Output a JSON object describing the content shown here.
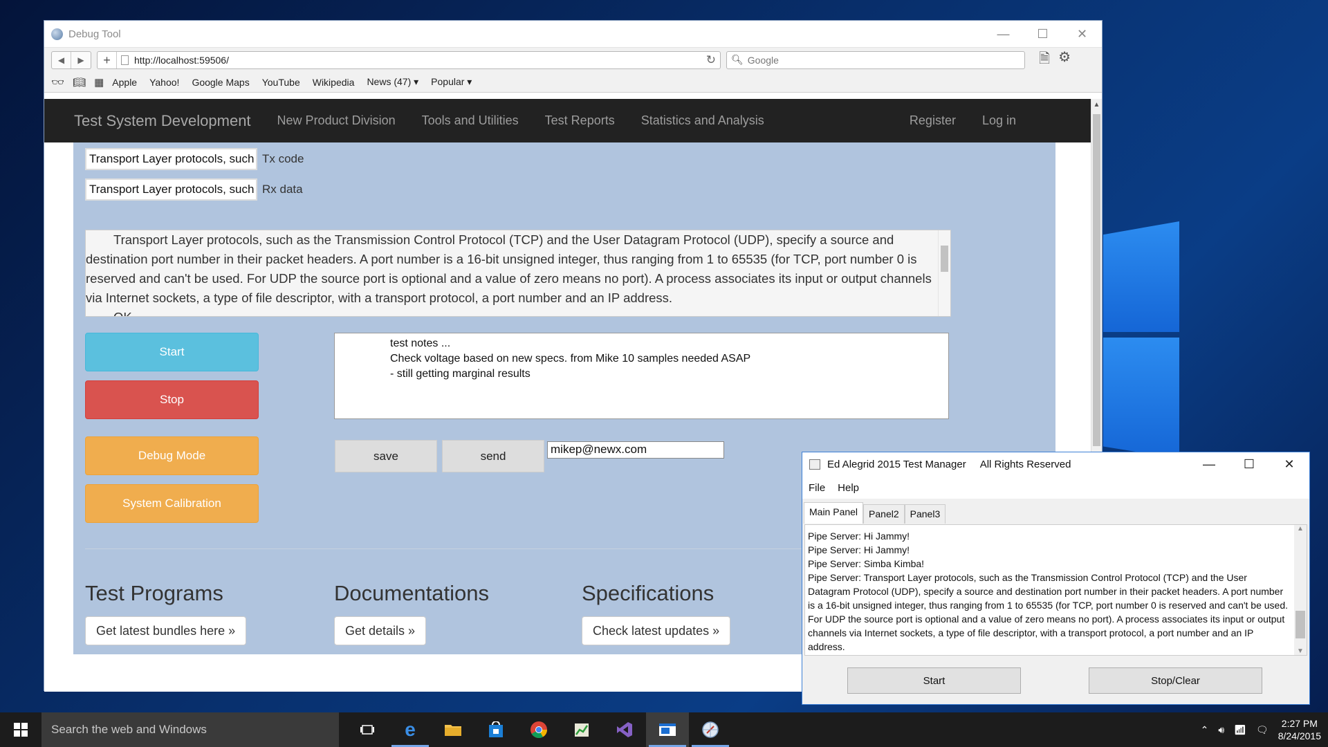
{
  "desktop": {},
  "browser": {
    "title": "Debug Tool",
    "url": "http://localhost:59506/",
    "search_placeholder": "Google",
    "bookmarks": [
      "Apple",
      "Yahoo!",
      "Google Maps",
      "YouTube",
      "Wikipedia",
      "News (47) ▾",
      "Popular ▾"
    ]
  },
  "site": {
    "brand": "Test System Development",
    "nav": [
      "New Product Division",
      "Tools and Utilities",
      "Test Reports",
      "Statistics and Analysis"
    ],
    "nav_right": [
      "Register",
      "Log in"
    ],
    "tx_value": "Transport Layer protocols, such as",
    "tx_label": "Tx code",
    "rx_value": "Transport Layer protocols, such as",
    "rx_label": "Rx data",
    "bigtext_p1": "Transport Layer protocols, such as the Transmission Control Protocol (TCP) and the User Datagram Protocol (UDP), specify a source and destination port number in their packet headers. A port number is a 16-bit unsigned integer, thus ranging from 1 to 65535 (for TCP, port number 0 is reserved and can't be used. For UDP the source port is optional and a value of zero means no port). A process associates its input or output channels via Internet sockets, a type of file descriptor, with a transport protocol, a port number and an IP address.",
    "bigtext_p2": "OK",
    "buttons": {
      "start": "Start",
      "stop": "Stop",
      "debug": "Debug Mode",
      "calibration": "System Calibration"
    },
    "notes_lines": [
      "test notes ...",
      "Check voltage based on new specs.  from Mike 10 samples  needed ASAP",
      "- still getting marginal results"
    ],
    "save_label": "save",
    "send_label": "send",
    "email_value": "mikep@newx.com",
    "sections": [
      {
        "heading": "Test Programs",
        "button": "Get latest bundles here »"
      },
      {
        "heading": "Documentations",
        "button": "Get details »"
      },
      {
        "heading": "Specifications",
        "button": "Check latest updates »"
      }
    ]
  },
  "test_manager": {
    "title": "Ed Alegrid 2015 Test Manager     All Rights Reserved",
    "menu": [
      "File",
      "Help"
    ],
    "tabs": [
      "Main Panel",
      "Panel2",
      "Panel3"
    ],
    "log": [
      "Pipe Server: Hi Jammy!",
      "Pipe Server: Hi Jammy!",
      "Pipe Server: Simba Kimba!",
      "Pipe Server: Transport Layer protocols, such as the Transmission Control Protocol (TCP) and the User Datagram Protocol (UDP), specify a source and destination port number in their packet headers. A port number is a 16-bit unsigned integer, thus ranging from 1 to 65535 (for TCP, port number 0 is reserved and can't be used. For UDP the source port is optional and a value of zero means no port). A process associates its input or output channels via Internet sockets, a type of file descriptor, with a transport protocol, a port number and an IP address."
    ],
    "start_label": "Start",
    "stop_label": "Stop/Clear"
  },
  "taskbar": {
    "search_placeholder": "Search the web and Windows",
    "time": "2:27 PM",
    "date": "8/24/2015"
  },
  "colors": {
    "start_btn": "#5bc0de",
    "stop_btn": "#d9534f",
    "warning_btn": "#f0ad4e",
    "content_bg": "#b0c4de",
    "navbar_bg": "#222222"
  }
}
